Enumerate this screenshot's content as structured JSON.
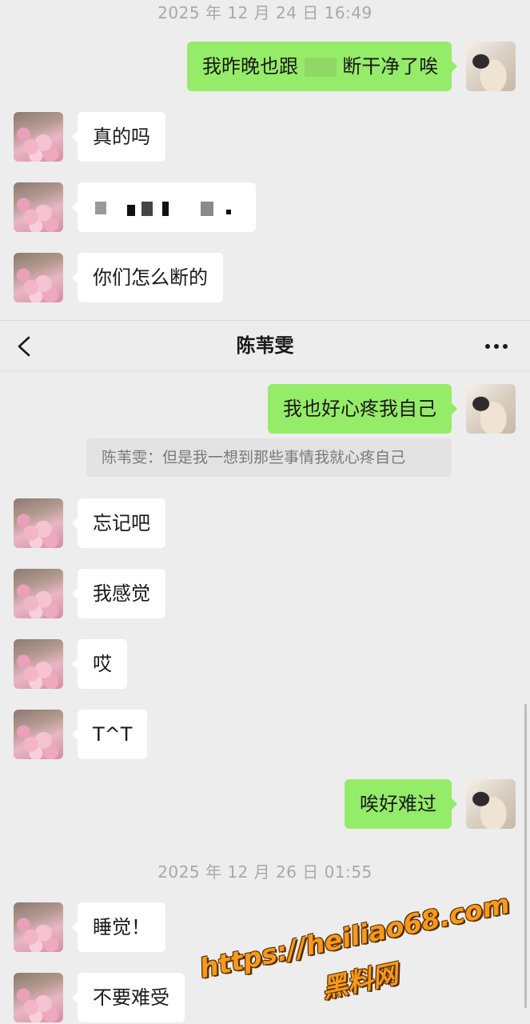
{
  "header": {
    "title": "陈苇雯"
  },
  "timestamps": [
    "2025 年 12 月 24 日 16:49",
    "2025 年 12 月 26 日 01:55"
  ],
  "messages": {
    "m1": "我昨晚也跟",
    "m1b": "断干净了唉",
    "m2": "真的吗",
    "m4": "你们怎么断的",
    "m5": "我也好心疼我自己",
    "quote": "陈苇雯：但是我一想到那些事情我就心疼自己",
    "m6": "忘记吧",
    "m7": "我感觉",
    "m8": "哎",
    "m9": "T^T",
    "m10": "唉好难过",
    "m11": "睡觉！",
    "m12": "不要难受"
  },
  "watermark": {
    "url": "https://heiliao68.com",
    "name": "黑料网"
  },
  "icons": [
    "back-arrow-icon",
    "more-dots-icon"
  ],
  "colors": {
    "background": "#ededed",
    "outgoing_bubble": "#95ec69",
    "incoming_bubble": "#ffffff",
    "watermark": "#f59a1c"
  }
}
